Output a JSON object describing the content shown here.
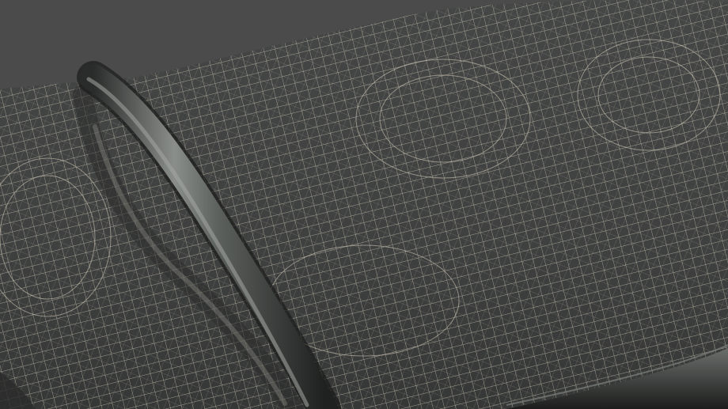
{
  "scene": {
    "subject": "wireframe-cushion-with-tube",
    "colors": {
      "background": "#4b4b4b",
      "wire": "#d8d2bd",
      "surface_dark": "#3f4040",
      "surface_mid": "#4a4b4a",
      "tube_light": "#8a8e8a",
      "tube_mid": "#5b5f5c",
      "tube_dark": "#222423"
    }
  }
}
